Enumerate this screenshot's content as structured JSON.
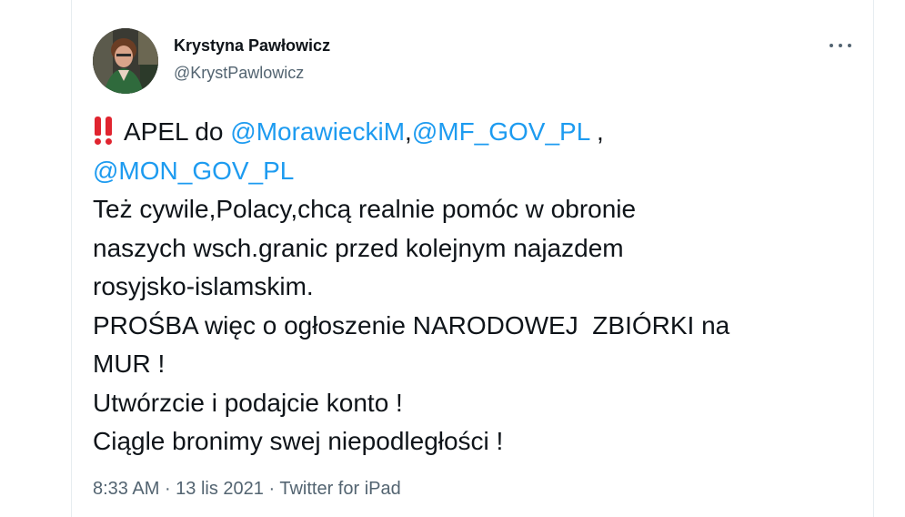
{
  "author": {
    "display_name": "Krystyna Pawłowicz",
    "handle": "@KrystPawlowicz",
    "avatar_icon": "profile-photo"
  },
  "menu": {
    "icon": "more-horizontal-icon"
  },
  "tweet": {
    "emoji": "‼️",
    "line1_text": "APEL do ",
    "mention1": "@MorawieckiM",
    "sep1": ",",
    "mention2": "@MF_GOV_PL",
    "sep2": " ,",
    "mention3": "@MON_GOV_PL",
    "lines": [
      "Też cywile,Polacy,chcą realnie pomóc w obronie",
      "naszych wsch.granic przed kolejnym najazdem",
      "rosyjsko-islamskim.",
      "PROŚBA więc o ogłoszenie NARODOWEJ  ZBIÓRKI na",
      "MUR !",
      "Utwórzcie i podajcie konto !",
      "Ciągle bronimy swej niepodległości !"
    ]
  },
  "meta": {
    "time": "8:33 AM",
    "dot1": " · ",
    "date": "13 lis 2021",
    "dot2": " · ",
    "source": "Twitter for iPad"
  },
  "colors": {
    "link": "#1d9bf0",
    "text": "#0f1419",
    "secondary": "#536471",
    "emoji_red": "#e0242f"
  }
}
